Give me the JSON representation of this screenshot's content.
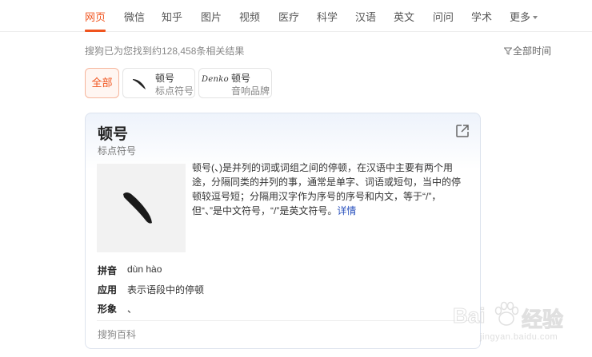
{
  "nav": {
    "items": [
      {
        "label": "网页",
        "active": true
      },
      {
        "label": "微信"
      },
      {
        "label": "知乎"
      },
      {
        "label": "图片"
      },
      {
        "label": "视频"
      },
      {
        "label": "医疗"
      },
      {
        "label": "科学"
      },
      {
        "label": "汉语"
      },
      {
        "label": "英文"
      },
      {
        "label": "问问"
      },
      {
        "label": "学术"
      },
      {
        "label": "更多"
      }
    ]
  },
  "results": {
    "count_text": "搜狗已为您找到约128,458条相关结果",
    "time_filter": "全部时间"
  },
  "chips": {
    "all": "全部",
    "items": [
      {
        "title": "顿号",
        "subtitle": "标点符号"
      },
      {
        "title": "顿号",
        "subtitle": "音响品牌",
        "logo_text": "Denko"
      }
    ]
  },
  "card": {
    "title": "顿号",
    "subtitle": "标点符号",
    "description": "顿号(、)是并列的词或词组之间的停顿，在汉语中主要有两个用途，分隔同类的并列的事，通常是单字、词语或短句，当中的停顿较逗号短；分隔用汉字作为序号的序号和内文，等于“/”，但“、”是中文符号，“/”是英文符号。",
    "detail_link": "详情",
    "attributes": [
      {
        "label": "拼音",
        "value": "dùn hào"
      },
      {
        "label": "应用",
        "value": "表示语段中的停顿"
      },
      {
        "label": "形象",
        "value": "、"
      }
    ],
    "source": "搜狗百科"
  },
  "watermark": {
    "text1": "Bai",
    "text2": "经验",
    "url": "jingyan.baidu.com"
  },
  "colors": {
    "accent": "#f0541e",
    "link": "#2a52be"
  }
}
